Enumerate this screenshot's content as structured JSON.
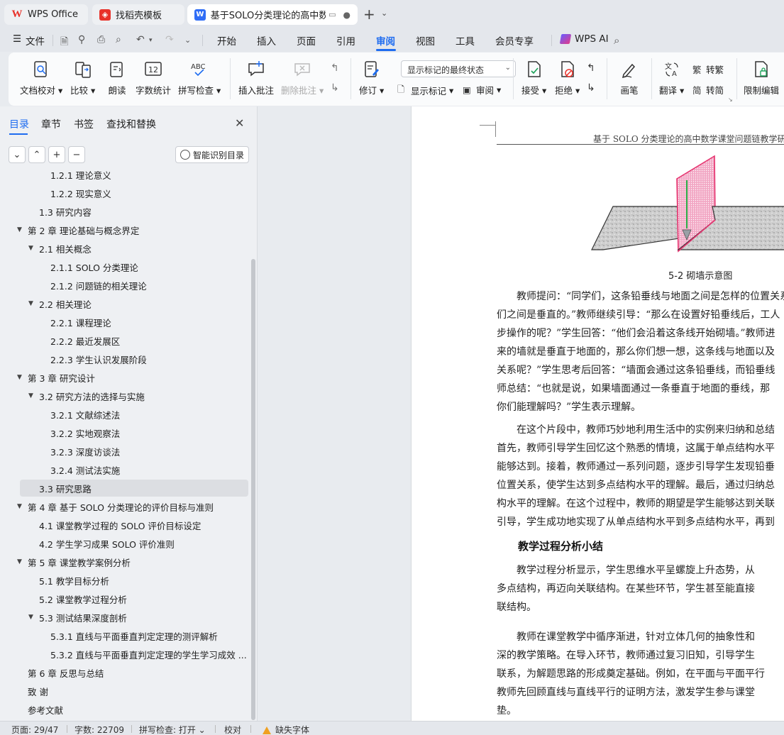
{
  "tabs": [
    {
      "label": "WPS Office"
    },
    {
      "label": "找稻壳模板"
    },
    {
      "label": "基于SOLO分类理论的高中数学"
    }
  ],
  "menu": {
    "file": "文件",
    "items": [
      "开始",
      "插入",
      "页面",
      "引用",
      "审阅",
      "视图",
      "工具",
      "会员专享"
    ],
    "active": "审阅",
    "ai": "WPS AI"
  },
  "ribbon": {
    "doc_check": "文档校对",
    "compare": "比较",
    "read_aloud": "朗读",
    "word_count": "字数统计",
    "spell_check": "拼写检查",
    "insert_comment": "插入批注",
    "delete_comment": "删除批注",
    "revise": "修订",
    "markup_mode": "显示标记的最终状态",
    "show_markup": "显示标记",
    "review": "审阅",
    "accept": "接受",
    "reject": "拒绝",
    "pen": "画笔",
    "translate": "翻译",
    "to_traditional": "转繁",
    "to_simplified": "转简",
    "restrict_edit": "限制编辑"
  },
  "panel": {
    "tabs": [
      "目录",
      "章节",
      "书签",
      "查找和替换"
    ],
    "smart_toc": "智能识别目录",
    "toc": [
      {
        "text": "1.2.1  理论意义",
        "level": 3
      },
      {
        "text": "1.2.2  现实意义",
        "level": 3
      },
      {
        "text": "1.3  研究内容",
        "level": 2
      },
      {
        "text": "第 2 章  理论基础与概念界定",
        "level": 1,
        "arrow": true
      },
      {
        "text": "2.1  相关概念",
        "level": 2,
        "arrow": true
      },
      {
        "text": "2.1.1 SOLO 分类理论",
        "level": 3
      },
      {
        "text": "2.1.2  问题链的相关理论",
        "level": 3
      },
      {
        "text": "2.2  相关理论",
        "level": 2,
        "arrow": true
      },
      {
        "text": "2.2.1  课程理论",
        "level": 3
      },
      {
        "text": "2.2.2  最近发展区",
        "level": 3
      },
      {
        "text": "2.2.3  学生认识发展阶段",
        "level": 3
      },
      {
        "text": "第 3 章  研究设计",
        "level": 1,
        "arrow": true
      },
      {
        "text": "3.2  研究方法的选择与实施",
        "level": 2,
        "arrow": true
      },
      {
        "text": "3.2.1  文献综述法",
        "level": 3
      },
      {
        "text": "3.2.2  实地观察法",
        "level": 3
      },
      {
        "text": "3.2.3  深度访谈法",
        "level": 3
      },
      {
        "text": "3.2.4  测试法实施",
        "level": 3
      },
      {
        "text": "3.3  研究思路",
        "level": 2,
        "selected": true
      },
      {
        "text": "第 4 章  基于 SOLO 分类理论的评价目标与准则",
        "level": 1,
        "arrow": true
      },
      {
        "text": "4.1  课堂教学过程的 SOLO 评价目标设定",
        "level": 2
      },
      {
        "text": "4.2  学生学习成果 SOLO 评价准则",
        "level": 2
      },
      {
        "text": "第 5 章  课堂教学案例分析",
        "level": 1,
        "arrow": true
      },
      {
        "text": "5.1  教学目标分析",
        "level": 2
      },
      {
        "text": "5.2  课堂教学过程分析",
        "level": 2
      },
      {
        "text": "5.3  测试结果深度剖析",
        "level": 2,
        "arrow": true
      },
      {
        "text": "5.3.1  直线与平面垂直判定定理的测评解析",
        "level": 3
      },
      {
        "text": "5.3.2  直线与平面垂直判定定理的学生学习成效 ...",
        "level": 3
      },
      {
        "text": "第 6 章  反思与总结",
        "level": 1
      },
      {
        "text": "致    谢",
        "level": 1
      },
      {
        "text": "参考文献",
        "level": 1
      }
    ]
  },
  "doc": {
    "header": "基于 SOLO 分类理论的高中数学课堂问题链教学研究",
    "caption": "5-2  砌墙示意图",
    "para1": [
      "教师提问：“同学们，这条铅垂线与地面之间是怎样的位置关系",
      "们之间是垂直的。”教师继续引导：“那么在设置好铅垂线后，工人",
      "步操作的呢？”学生回答：“他们会沿着这条线开始砌墙。”教师进",
      "来的墙就是垂直于地面的，那么你们想一想，这条线与地面以及",
      "关系呢？”学生思考后回答：“墙面会通过这条铅垂线，而铅垂线",
      "师总结：“也就是说，如果墙面通过一条垂直于地面的垂线，那",
      "你们能理解吗？”学生表示理解。"
    ],
    "para2": [
      "在这个片段中，教师巧妙地利用生活中的实例来归纳和总结",
      "首先，教师引导学生回忆这个熟悉的情境，这属于单点结构水平",
      "能够达到。接着，教师通过一系列问题，逐步引导学生发现铅垂",
      "位置关系，使学生达到多点结构水平的理解。最后，通过归纳总",
      "构水平的理解。在这个过程中，教师的期望是学生能够达到关联",
      "引导，学生成功地实现了从单点结构水平到多点结构水平，再到"
    ],
    "heading": "教学过程分析小结",
    "para3": [
      "教学过程分析显示，学生思维水平呈螺旋上升态势，从",
      "多点结构，再迈向关联结构。在某些环节，学生甚至能直接",
      "联结构。"
    ],
    "para4": [
      "教师在课堂教学中循序渐进，针对立体几何的抽象性和",
      "深的教学策略。在导入环节，教师通过复习旧知，引导学生",
      "联系，为解题思路的形成奠定基础。例如，在平面与平面平行",
      "教师先回顾直线与直线平行的证明方法，激发学生参与课堂",
      "垫。"
    ]
  },
  "status": {
    "page": "页面: 29/47",
    "words": "字数: 22709",
    "spell": "拼写检查: 打开",
    "proof": "校对",
    "missing_font": "缺失字体"
  },
  "colors": {
    "accent": "#1e6cf0",
    "wps_red": "#e8322a",
    "plane": "#e6336f"
  }
}
